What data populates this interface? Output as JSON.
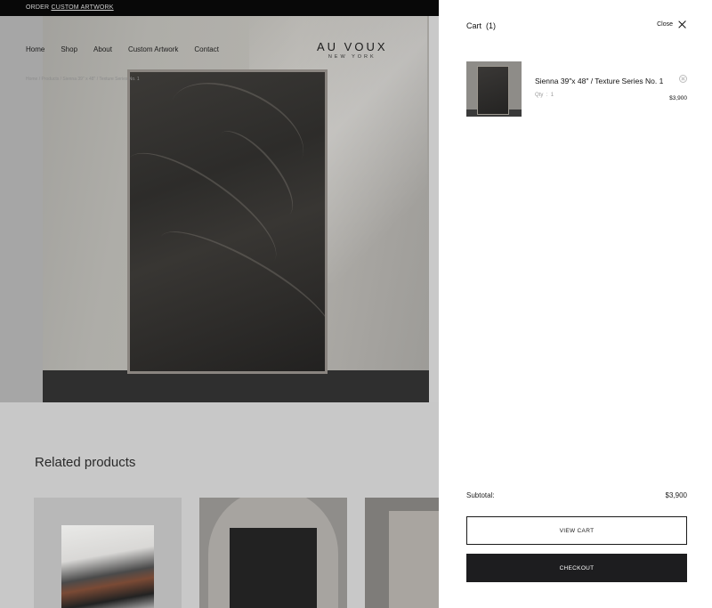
{
  "announcement": {
    "prefix": "ORDER",
    "link": "CUSTOM ARTWORK"
  },
  "nav": {
    "items": [
      "Home",
      "Shop",
      "About",
      "Custom Artwork",
      "Contact"
    ]
  },
  "logo": {
    "main": "AU VOUX",
    "sub": "NEW YORK"
  },
  "breadcrumb": "Home / Products / Sienna 39\" x 48\" / Texture Series No. 1",
  "related": {
    "heading": "Related products"
  },
  "cart": {
    "title": "Cart",
    "count": "(1)",
    "close_label": "Close",
    "item": {
      "name": "Sienna 39″x 48″ / Texture Series No. 1",
      "qty_label": "Qty",
      "qty": "1",
      "price": "$3,900"
    },
    "subtotal_label": "Subtotal:",
    "subtotal_value": "$3,900",
    "view_cart_label": "VIEW CART",
    "checkout_label": "CHECKOUT"
  },
  "colors": {
    "drawer_bg": "#ffffff",
    "checkout_bg": "#1d1d1f",
    "overlay": "#c8c8c8"
  }
}
